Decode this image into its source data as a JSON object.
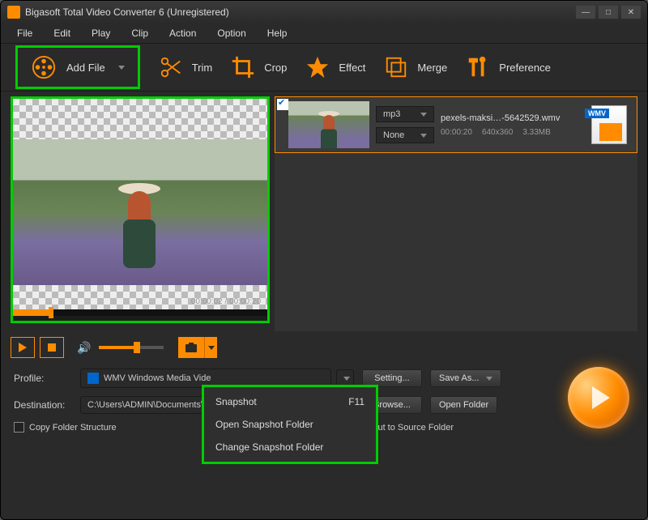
{
  "window": {
    "title": "Bigasoft Total Video Converter 6 (Unregistered)"
  },
  "menubar": [
    "File",
    "Edit",
    "Play",
    "Clip",
    "Action",
    "Option",
    "Help"
  ],
  "toolbar": {
    "add_file": "Add File",
    "trim": "Trim",
    "crop": "Crop",
    "effect": "Effect",
    "merge": "Merge",
    "preference": "Preference"
  },
  "preview": {
    "time": "00:00:02 / 00:00:20"
  },
  "file": {
    "name": "pexels-maksi…-5642529.wmv",
    "format_dd": "mp3",
    "secondary_dd": "None",
    "duration": "00:00:20",
    "resolution": "640x360",
    "size": "3.33MB",
    "type_label": "WMV"
  },
  "context_menu": {
    "snapshot": "Snapshot",
    "snapshot_key": "F11",
    "open_folder": "Open Snapshot Folder",
    "change_folder": "Change Snapshot Folder"
  },
  "profile": {
    "label": "Profile:",
    "value": "WMV Windows Media Vide",
    "setting": "Setting...",
    "save_as": "Save As..."
  },
  "destination": {
    "label": "Destination:",
    "value": "C:\\Users\\ADMIN\\Documents\\B",
    "browse": "Browse...",
    "open_folder": "Open Folder"
  },
  "checks": {
    "copy_structure": "Copy Folder Structure",
    "output_source": "Output to Source Folder"
  },
  "colors": {
    "accent": "#ff8c00",
    "highlight": "#00cc00"
  }
}
